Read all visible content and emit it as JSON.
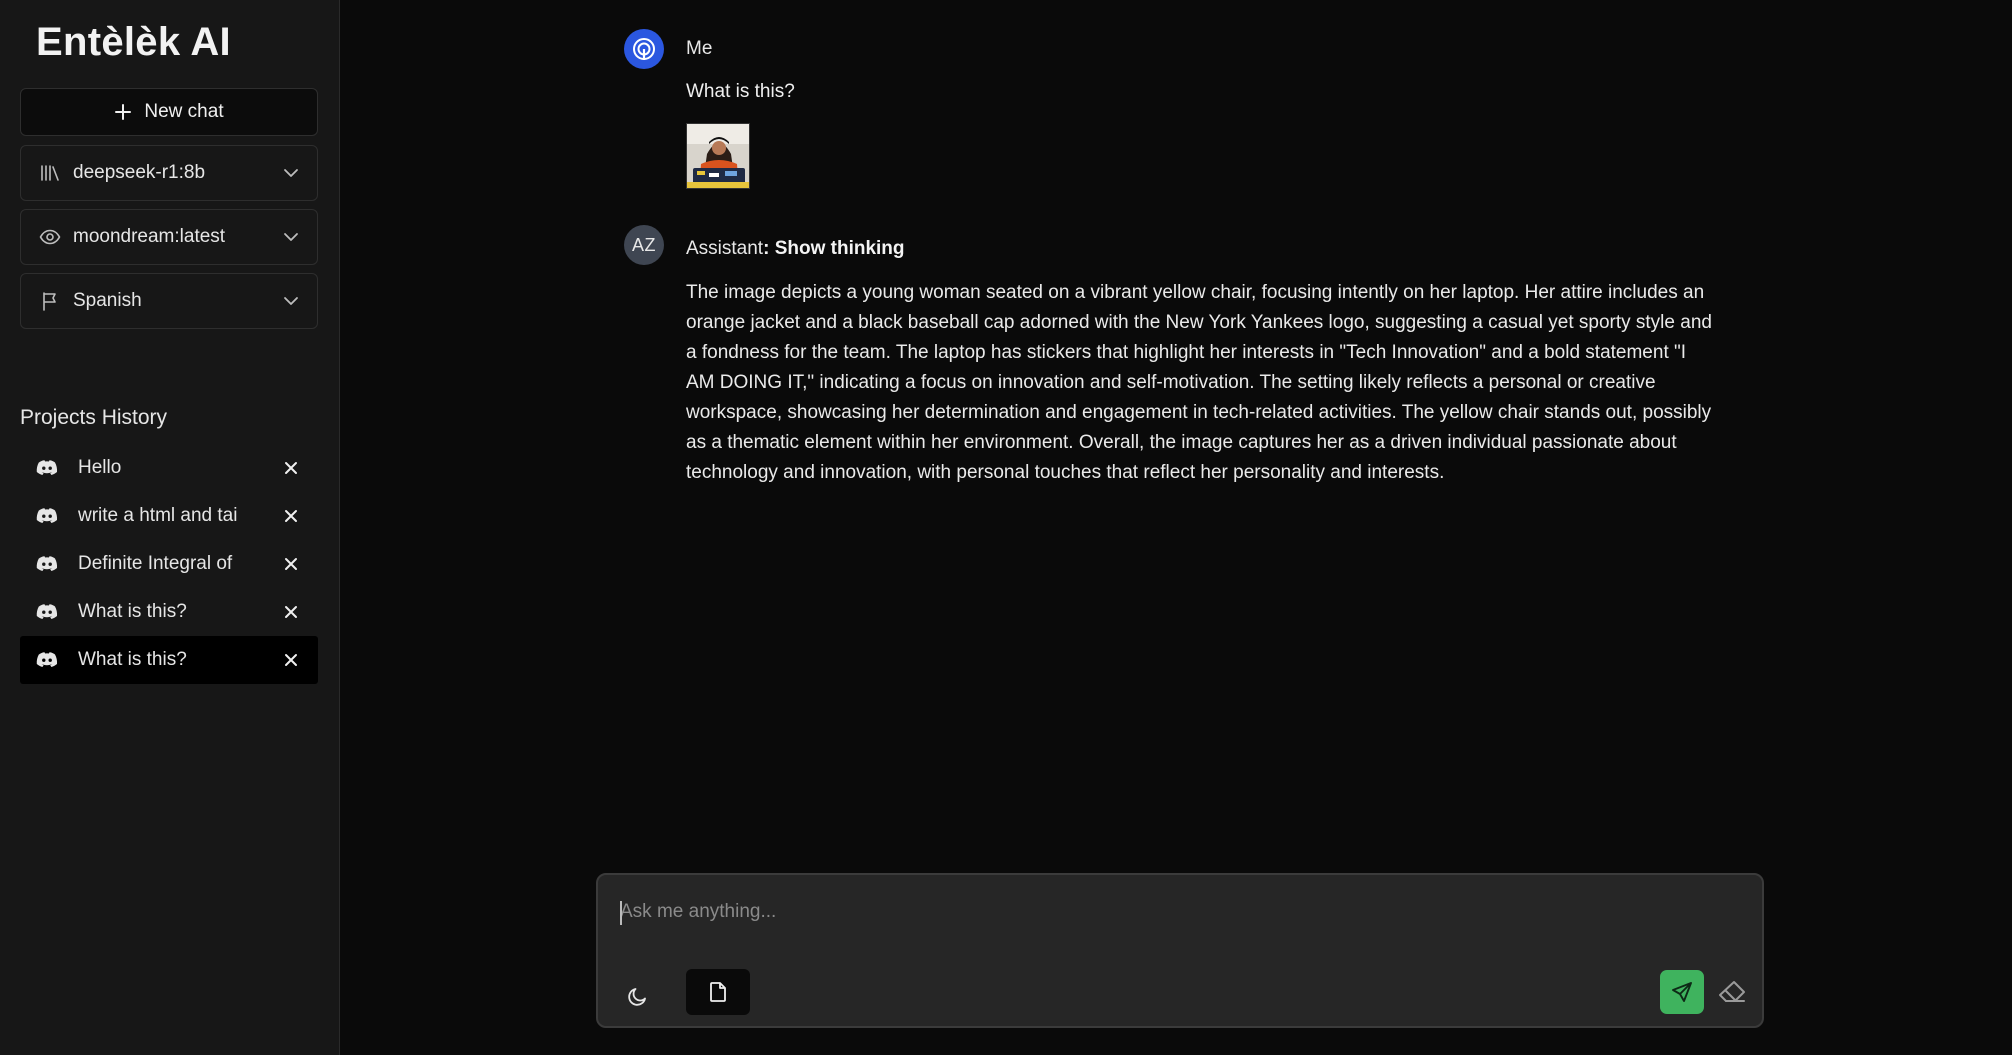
{
  "app": {
    "title": "Entèlèk AI"
  },
  "sidebar": {
    "new_chat_label": "New chat",
    "model_select": {
      "value": "deepseek-r1:8b",
      "icon": "library-icon"
    },
    "vision_select": {
      "value": "moondream:latest",
      "icon": "eye-icon"
    },
    "language_select": {
      "value": "Spanish",
      "icon": "flag-icon"
    },
    "history_title": "Projects History",
    "history": [
      {
        "label": "Hello",
        "active": false
      },
      {
        "label": "write a html and tai",
        "active": false
      },
      {
        "label": "Definite Integral of",
        "active": false
      },
      {
        "label": "What is this?",
        "active": false
      },
      {
        "label": "What is this?",
        "active": true
      }
    ]
  },
  "chat": {
    "user": {
      "name": "Me",
      "question": "What is this?",
      "attachment": "photo-thumbnail"
    },
    "assistant": {
      "initials": "AZ",
      "name": "Assistant",
      "thinking_label": ": Show thinking",
      "answer": "The image depicts a young woman seated on a vibrant yellow chair, focusing intently on her laptop. Her attire includes an orange jacket and a black baseball cap adorned with the New York Yankees logo, suggesting a casual yet sporty style and a fondness for the team. The laptop has stickers that highlight her interests in \"Tech Innovation\" and a bold statement \"I AM DOING IT,\" indicating a focus on innovation and self-motivation. The setting likely reflects a personal or creative workspace, showcasing her determination and engagement in tech-related activities. The yellow chair stands out, possibly as a thematic element within her environment. Overall, the image captures her as a driven individual passionate about technology and innovation, with personal touches that reflect her personality and interests."
    }
  },
  "composer": {
    "placeholder": "Ask me anything...",
    "value": ""
  },
  "colors": {
    "sidebar_bg": "#171717",
    "main_bg": "#0a0a0a",
    "send_button": "#3fb35e",
    "user_avatar": "#2b57e0"
  }
}
